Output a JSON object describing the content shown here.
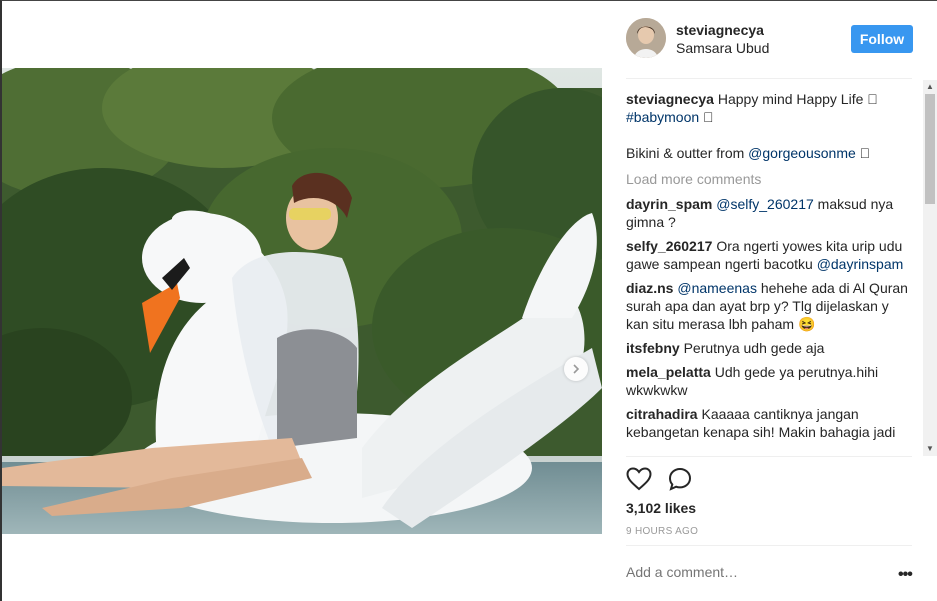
{
  "post": {
    "username": "steviagnecya",
    "location": "Samsara Ubud",
    "follow_label": "Follow",
    "caption_user": "steviagnecya",
    "caption_text": "Happy mind Happy Life 🏻",
    "caption_tag": "#babymoon",
    "caption_tag_tail": " 🏻",
    "caption_line2": "Bikini & outter from ",
    "caption_mention": "@gorgeousonme",
    "caption_mention_tail": " 🏻",
    "load_more": "Load more comments",
    "likes": "3,102 likes",
    "time": "9 HOURS AGO",
    "add_comment_placeholder": "Add a comment…",
    "more_label": "•••"
  },
  "comments": [
    {
      "user": "dayrin_spam",
      "mention": "@selfy_260217",
      "text": " maksud nya gimna ?"
    },
    {
      "user": "selfy_260217",
      "mention": "",
      "text": "Ora ngerti yowes kita urip udu gawe sampean ngerti bacotku ",
      "mention_end": "@dayrinspam"
    },
    {
      "user": "diaz.ns",
      "mention": "@nameenas",
      "text": " hehehe ada di Al Quran surah apa dan ayat brp y? Tlg dijelaskan y kan situ merasa lbh paham 😆"
    },
    {
      "user": "itsfebny",
      "mention": "",
      "text": "Perutnya udh gede aja"
    },
    {
      "user": "mela_pelatta",
      "mention": "",
      "text": "Udh gede ya perutnya.hihi wkwkwkw"
    },
    {
      "user": "citrahadira",
      "mention": "",
      "text": "Kaaaaa cantiknya jangan kebangetan kenapa sih! Makin bahagia jadi"
    }
  ],
  "colors": {
    "accent": "#3897f0",
    "link": "#003569",
    "muted": "#999999"
  },
  "icons": [
    "heart-icon",
    "comment-icon",
    "chevron-right-icon",
    "more-icon"
  ]
}
